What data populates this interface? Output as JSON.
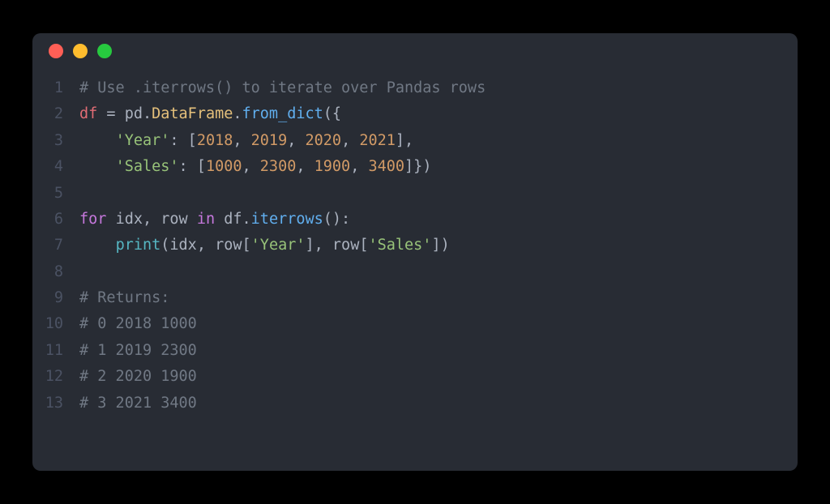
{
  "window": {
    "dots": [
      "red",
      "yellow",
      "green"
    ]
  },
  "code": {
    "lines": [
      {
        "n": "1",
        "tokens": [
          {
            "c": "tok-comment",
            "t": "# Use .iterrows() to iterate over Pandas rows"
          }
        ]
      },
      {
        "n": "2",
        "tokens": [
          {
            "c": "tok-ident",
            "t": "df"
          },
          {
            "c": "tok-op",
            "t": " = "
          },
          {
            "c": "tok-attr2",
            "t": "pd"
          },
          {
            "c": "tok-punct",
            "t": "."
          },
          {
            "c": "tok-attr",
            "t": "DataFrame"
          },
          {
            "c": "tok-punct",
            "t": "."
          },
          {
            "c": "tok-func",
            "t": "from_dict"
          },
          {
            "c": "tok-punct",
            "t": "({"
          }
        ]
      },
      {
        "n": "3",
        "tokens": [
          {
            "c": "",
            "t": "    "
          },
          {
            "c": "tok-string",
            "t": "'Year'"
          },
          {
            "c": "tok-punct",
            "t": ": ["
          },
          {
            "c": "tok-number",
            "t": "2018"
          },
          {
            "c": "tok-punct",
            "t": ", "
          },
          {
            "c": "tok-number",
            "t": "2019"
          },
          {
            "c": "tok-punct",
            "t": ", "
          },
          {
            "c": "tok-number",
            "t": "2020"
          },
          {
            "c": "tok-punct",
            "t": ", "
          },
          {
            "c": "tok-number",
            "t": "2021"
          },
          {
            "c": "tok-punct",
            "t": "],"
          }
        ]
      },
      {
        "n": "4",
        "tokens": [
          {
            "c": "",
            "t": "    "
          },
          {
            "c": "tok-string",
            "t": "'Sales'"
          },
          {
            "c": "tok-punct",
            "t": ": ["
          },
          {
            "c": "tok-number",
            "t": "1000"
          },
          {
            "c": "tok-punct",
            "t": ", "
          },
          {
            "c": "tok-number",
            "t": "2300"
          },
          {
            "c": "tok-punct",
            "t": ", "
          },
          {
            "c": "tok-number",
            "t": "1900"
          },
          {
            "c": "tok-punct",
            "t": ", "
          },
          {
            "c": "tok-number",
            "t": "3400"
          },
          {
            "c": "tok-punct",
            "t": "]})"
          }
        ]
      },
      {
        "n": "5",
        "tokens": []
      },
      {
        "n": "6",
        "tokens": [
          {
            "c": "tok-keyword",
            "t": "for"
          },
          {
            "c": "",
            "t": " "
          },
          {
            "c": "tok-attr2",
            "t": "idx"
          },
          {
            "c": "tok-punct",
            "t": ", "
          },
          {
            "c": "tok-attr2",
            "t": "row"
          },
          {
            "c": "",
            "t": " "
          },
          {
            "c": "tok-keyword",
            "t": "in"
          },
          {
            "c": "",
            "t": " "
          },
          {
            "c": "tok-attr2",
            "t": "df"
          },
          {
            "c": "tok-punct",
            "t": "."
          },
          {
            "c": "tok-func",
            "t": "iterrows"
          },
          {
            "c": "tok-punct",
            "t": "():"
          }
        ]
      },
      {
        "n": "7",
        "tokens": [
          {
            "c": "",
            "t": "    "
          },
          {
            "c": "tok-builtin",
            "t": "print"
          },
          {
            "c": "tok-punct",
            "t": "("
          },
          {
            "c": "tok-attr2",
            "t": "idx"
          },
          {
            "c": "tok-punct",
            "t": ", "
          },
          {
            "c": "tok-attr2",
            "t": "row"
          },
          {
            "c": "tok-punct",
            "t": "["
          },
          {
            "c": "tok-string",
            "t": "'Year'"
          },
          {
            "c": "tok-punct",
            "t": "], "
          },
          {
            "c": "tok-attr2",
            "t": "row"
          },
          {
            "c": "tok-punct",
            "t": "["
          },
          {
            "c": "tok-string",
            "t": "'Sales'"
          },
          {
            "c": "tok-punct",
            "t": "])"
          }
        ]
      },
      {
        "n": "8",
        "tokens": []
      },
      {
        "n": "9",
        "tokens": [
          {
            "c": "tok-comment",
            "t": "# Returns:"
          }
        ]
      },
      {
        "n": "10",
        "tokens": [
          {
            "c": "tok-comment",
            "t": "# 0 2018 1000"
          }
        ]
      },
      {
        "n": "11",
        "tokens": [
          {
            "c": "tok-comment",
            "t": "# 1 2019 2300"
          }
        ]
      },
      {
        "n": "12",
        "tokens": [
          {
            "c": "tok-comment",
            "t": "# 2 2020 1900"
          }
        ]
      },
      {
        "n": "13",
        "tokens": [
          {
            "c": "tok-comment",
            "t": "# 3 2021 3400"
          }
        ]
      }
    ]
  }
}
